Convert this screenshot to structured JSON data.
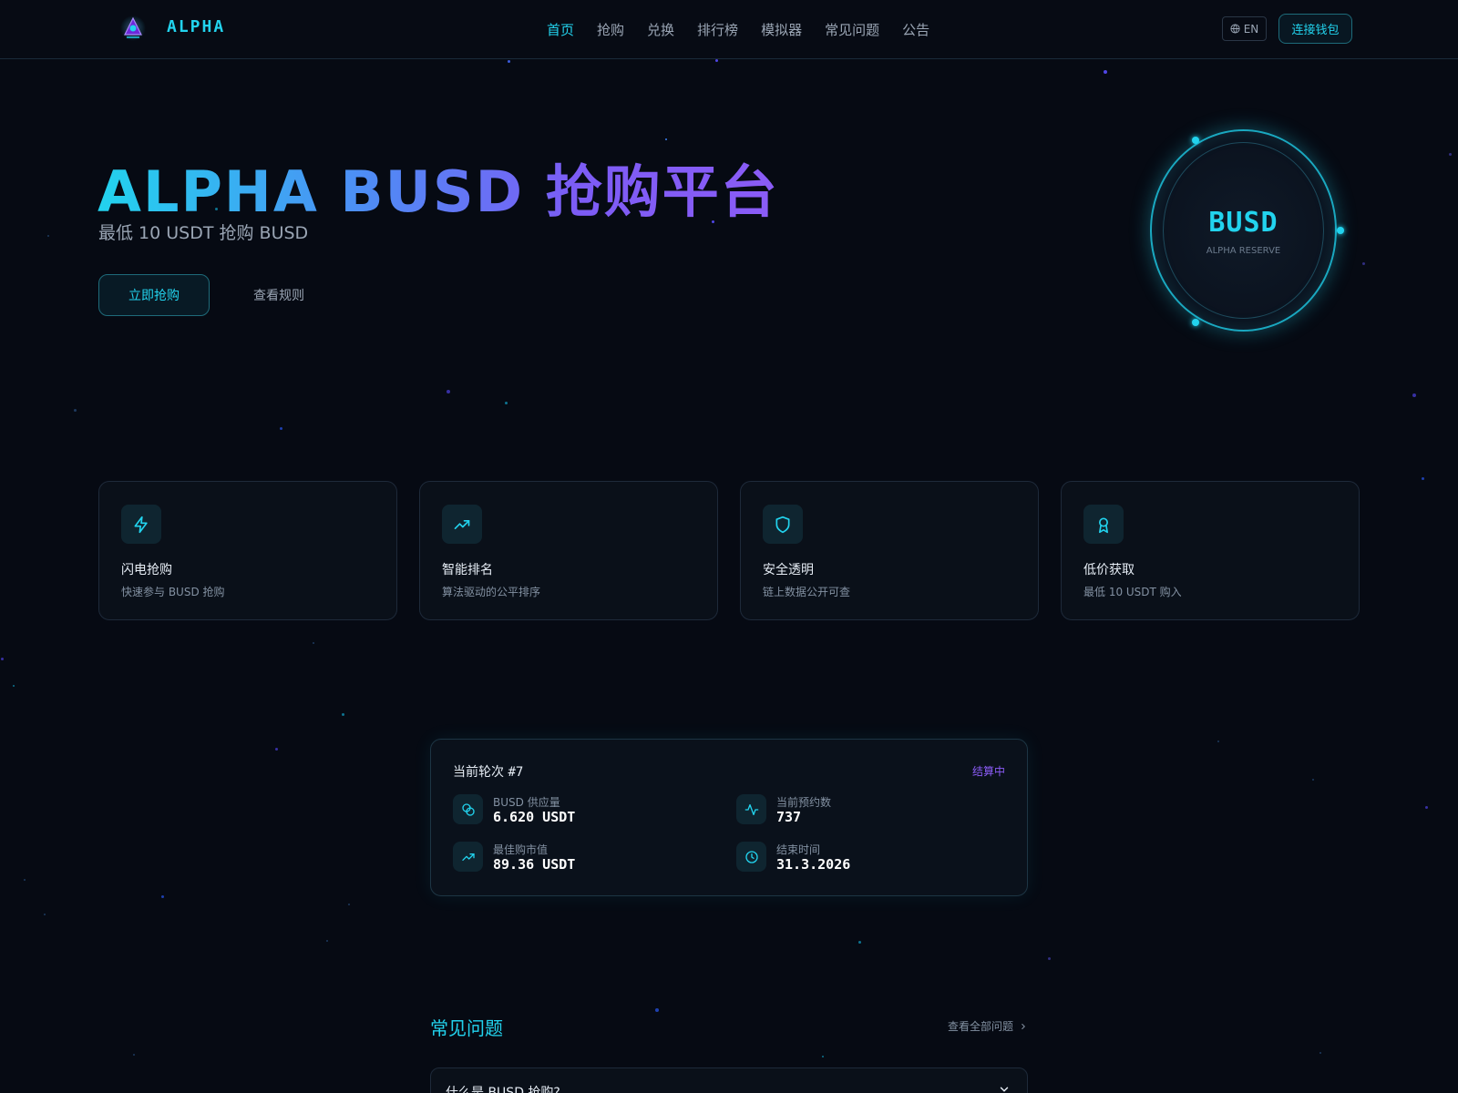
{
  "brand": {
    "name": "ALPHA"
  },
  "nav": {
    "items": [
      {
        "label": "首页"
      },
      {
        "label": "抢购"
      },
      {
        "label": "兑换"
      },
      {
        "label": "排行榜"
      },
      {
        "label": "模拟器"
      },
      {
        "label": "常见问题"
      },
      {
        "label": "公告"
      }
    ],
    "active_index": 0
  },
  "header": {
    "language": "EN",
    "connect_wallet": "连接钱包"
  },
  "hero": {
    "title": "ALPHA BUSD 抢购平台",
    "subtitle": "最低 10 USDT 抢购 BUSD",
    "primary_button": "立即抢购",
    "secondary_button": "查看规则"
  },
  "coin": {
    "title": "BUSD",
    "subtitle": "ALPHA RESERVE"
  },
  "features": [
    {
      "icon": "lightning-icon",
      "title": "闪电抢购",
      "desc": "快速参与 BUSD 抢购"
    },
    {
      "icon": "trending-up-icon",
      "title": "智能排名",
      "desc": "算法驱动的公平排序"
    },
    {
      "icon": "shield-icon",
      "title": "安全透明",
      "desc": "链上数据公开可查"
    },
    {
      "icon": "award-icon",
      "title": "低价获取",
      "desc": "最低 10 USDT 购入"
    }
  ],
  "round": {
    "title_prefix": "当前轮次 ",
    "number": "#7",
    "status": "结算中",
    "stats": [
      {
        "icon": "coins-icon",
        "label": "BUSD 供应量",
        "value": "6.620 USDT"
      },
      {
        "icon": "activity-icon",
        "label": "当前预约数",
        "value": "737"
      },
      {
        "icon": "trending-up-icon",
        "label": "最佳购市值",
        "value": "89.36 USDT"
      },
      {
        "icon": "clock-icon",
        "label": "结束时间",
        "value": "31.3.2026"
      }
    ]
  },
  "faq": {
    "title": "常见问题",
    "view_all": "查看全部问题",
    "items": [
      {
        "question": "什么是 BUSD 抢购?"
      }
    ]
  },
  "colors": {
    "accent": "#22d3ee",
    "purple": "#8b5cf6",
    "background": "#060a13"
  }
}
